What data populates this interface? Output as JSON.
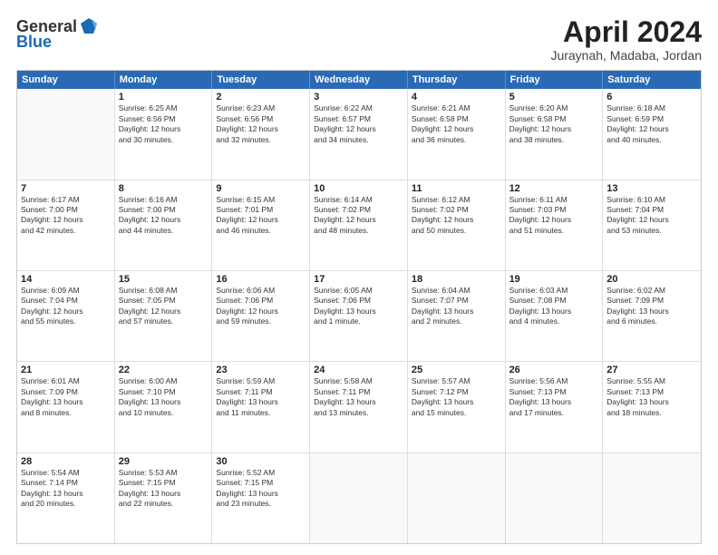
{
  "logo": {
    "general": "General",
    "blue": "Blue"
  },
  "header": {
    "title": "April 2024",
    "subtitle": "Juraynah, Madaba, Jordan"
  },
  "days": [
    "Sunday",
    "Monday",
    "Tuesday",
    "Wednesday",
    "Thursday",
    "Friday",
    "Saturday"
  ],
  "weeks": [
    [
      {
        "day": "",
        "text": ""
      },
      {
        "day": "1",
        "text": "Sunrise: 6:25 AM\nSunset: 6:56 PM\nDaylight: 12 hours\nand 30 minutes."
      },
      {
        "day": "2",
        "text": "Sunrise: 6:23 AM\nSunset: 6:56 PM\nDaylight: 12 hours\nand 32 minutes."
      },
      {
        "day": "3",
        "text": "Sunrise: 6:22 AM\nSunset: 6:57 PM\nDaylight: 12 hours\nand 34 minutes."
      },
      {
        "day": "4",
        "text": "Sunrise: 6:21 AM\nSunset: 6:58 PM\nDaylight: 12 hours\nand 36 minutes."
      },
      {
        "day": "5",
        "text": "Sunrise: 6:20 AM\nSunset: 6:58 PM\nDaylight: 12 hours\nand 38 minutes."
      },
      {
        "day": "6",
        "text": "Sunrise: 6:18 AM\nSunset: 6:59 PM\nDaylight: 12 hours\nand 40 minutes."
      }
    ],
    [
      {
        "day": "7",
        "text": "Sunrise: 6:17 AM\nSunset: 7:00 PM\nDaylight: 12 hours\nand 42 minutes."
      },
      {
        "day": "8",
        "text": "Sunrise: 6:16 AM\nSunset: 7:00 PM\nDaylight: 12 hours\nand 44 minutes."
      },
      {
        "day": "9",
        "text": "Sunrise: 6:15 AM\nSunset: 7:01 PM\nDaylight: 12 hours\nand 46 minutes."
      },
      {
        "day": "10",
        "text": "Sunrise: 6:14 AM\nSunset: 7:02 PM\nDaylight: 12 hours\nand 48 minutes."
      },
      {
        "day": "11",
        "text": "Sunrise: 6:12 AM\nSunset: 7:02 PM\nDaylight: 12 hours\nand 50 minutes."
      },
      {
        "day": "12",
        "text": "Sunrise: 6:11 AM\nSunset: 7:03 PM\nDaylight: 12 hours\nand 51 minutes."
      },
      {
        "day": "13",
        "text": "Sunrise: 6:10 AM\nSunset: 7:04 PM\nDaylight: 12 hours\nand 53 minutes."
      }
    ],
    [
      {
        "day": "14",
        "text": "Sunrise: 6:09 AM\nSunset: 7:04 PM\nDaylight: 12 hours\nand 55 minutes."
      },
      {
        "day": "15",
        "text": "Sunrise: 6:08 AM\nSunset: 7:05 PM\nDaylight: 12 hours\nand 57 minutes."
      },
      {
        "day": "16",
        "text": "Sunrise: 6:06 AM\nSunset: 7:06 PM\nDaylight: 12 hours\nand 59 minutes."
      },
      {
        "day": "17",
        "text": "Sunrise: 6:05 AM\nSunset: 7:06 PM\nDaylight: 13 hours\nand 1 minute."
      },
      {
        "day": "18",
        "text": "Sunrise: 6:04 AM\nSunset: 7:07 PM\nDaylight: 13 hours\nand 2 minutes."
      },
      {
        "day": "19",
        "text": "Sunrise: 6:03 AM\nSunset: 7:08 PM\nDaylight: 13 hours\nand 4 minutes."
      },
      {
        "day": "20",
        "text": "Sunrise: 6:02 AM\nSunset: 7:09 PM\nDaylight: 13 hours\nand 6 minutes."
      }
    ],
    [
      {
        "day": "21",
        "text": "Sunrise: 6:01 AM\nSunset: 7:09 PM\nDaylight: 13 hours\nand 8 minutes."
      },
      {
        "day": "22",
        "text": "Sunrise: 6:00 AM\nSunset: 7:10 PM\nDaylight: 13 hours\nand 10 minutes."
      },
      {
        "day": "23",
        "text": "Sunrise: 5:59 AM\nSunset: 7:11 PM\nDaylight: 13 hours\nand 11 minutes."
      },
      {
        "day": "24",
        "text": "Sunrise: 5:58 AM\nSunset: 7:11 PM\nDaylight: 13 hours\nand 13 minutes."
      },
      {
        "day": "25",
        "text": "Sunrise: 5:57 AM\nSunset: 7:12 PM\nDaylight: 13 hours\nand 15 minutes."
      },
      {
        "day": "26",
        "text": "Sunrise: 5:56 AM\nSunset: 7:13 PM\nDaylight: 13 hours\nand 17 minutes."
      },
      {
        "day": "27",
        "text": "Sunrise: 5:55 AM\nSunset: 7:13 PM\nDaylight: 13 hours\nand 18 minutes."
      }
    ],
    [
      {
        "day": "28",
        "text": "Sunrise: 5:54 AM\nSunset: 7:14 PM\nDaylight: 13 hours\nand 20 minutes."
      },
      {
        "day": "29",
        "text": "Sunrise: 5:53 AM\nSunset: 7:15 PM\nDaylight: 13 hours\nand 22 minutes."
      },
      {
        "day": "30",
        "text": "Sunrise: 5:52 AM\nSunset: 7:15 PM\nDaylight: 13 hours\nand 23 minutes."
      },
      {
        "day": "",
        "text": ""
      },
      {
        "day": "",
        "text": ""
      },
      {
        "day": "",
        "text": ""
      },
      {
        "day": "",
        "text": ""
      }
    ]
  ]
}
